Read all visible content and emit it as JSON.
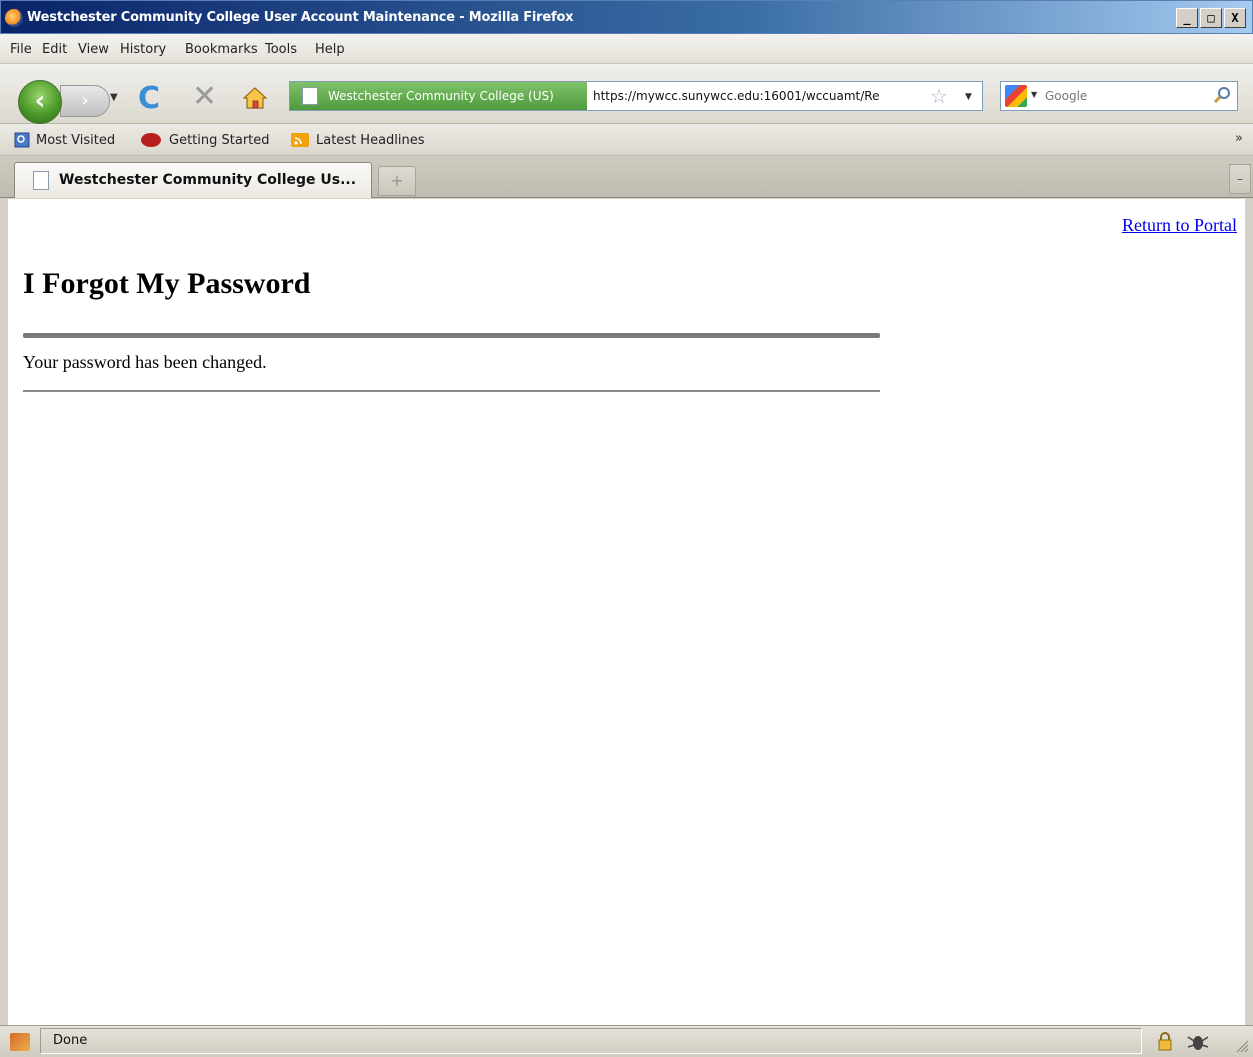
{
  "window": {
    "title": "Westchester Community College User Account Maintenance - Mozilla Firefox",
    "controls": [
      "_",
      "□",
      "X"
    ]
  },
  "menu": [
    "File",
    "Edit",
    "View",
    "History",
    "Bookmarks",
    "Tools",
    "Help"
  ],
  "nav": {
    "identity_label": "Westchester Community College (US)",
    "url": "https://mywcc.sunywcc.edu:16001/wccuamt/Re",
    "search_placeholder": "Google"
  },
  "bookmarks": [
    "Most Visited",
    "Getting Started",
    "Latest Headlines"
  ],
  "bookmarks_overflow": "»",
  "tabs": [
    {
      "label": "Westchester Community College Us...",
      "active": true
    }
  ],
  "page": {
    "return_link": "Return to Portal",
    "title": "I Forgot My Password",
    "message": "Your password has been changed."
  },
  "status": {
    "text": "Done"
  },
  "colors": {
    "link": "#0000ee",
    "identity_bg": "#5ca648",
    "rule": "#7a7a7a"
  },
  "icons": [
    "firefox-icon",
    "back-arrow-icon",
    "forward-arrow-icon",
    "reload-icon",
    "stop-icon",
    "home-icon",
    "page-icon",
    "star-icon",
    "google-icon",
    "magnifier-icon",
    "rss-icon",
    "lock-icon",
    "bug-icon"
  ]
}
